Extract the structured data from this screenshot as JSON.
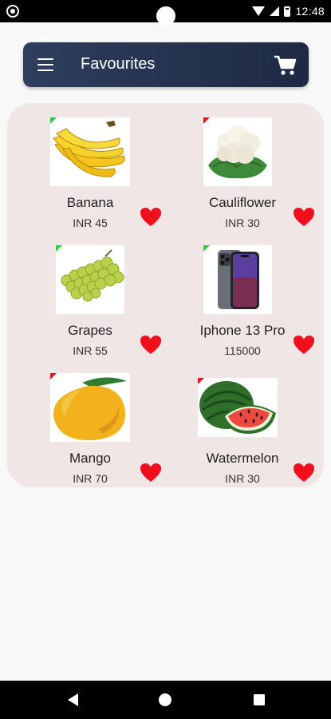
{
  "status": {
    "time": "12:48"
  },
  "app_bar": {
    "title": "Favourites"
  },
  "products": [
    {
      "name": "Banana",
      "price": "INR 45",
      "image_icon": "banana-icon",
      "tag_color": "#2ecc40"
    },
    {
      "name": "Cauliflower",
      "price": "INR 30",
      "image_icon": "cauliflower-icon",
      "tag_color": "#e0151e"
    },
    {
      "name": "Grapes",
      "price": "INR 55",
      "image_icon": "grapes-icon",
      "tag_color": "#2ecc40"
    },
    {
      "name": "Iphone 13 Pro",
      "price": "115000",
      "image_icon": "phone-icon",
      "tag_color": "#2ecc40"
    },
    {
      "name": "Mango",
      "price": "INR 70",
      "image_icon": "mango-icon",
      "tag_color": "#e0151e"
    },
    {
      "name": "Watermelon",
      "price": "INR 30",
      "image_icon": "watermelon-icon",
      "tag_color": "#e0151e"
    }
  ],
  "colors": {
    "heart": "#f20f1d",
    "app_bar": "#2f3e5d",
    "panel": "#f1e6e6"
  }
}
